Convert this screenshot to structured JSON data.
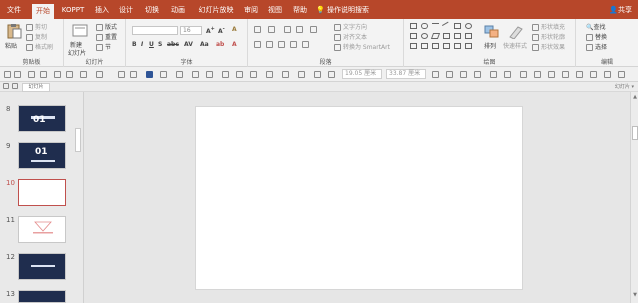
{
  "menu": {
    "tabs": [
      "文件",
      "开始",
      "KOPPT",
      "插入",
      "设计",
      "切换",
      "动画",
      "幻灯片放映",
      "审阅",
      "视图",
      "帮助"
    ],
    "active_tab": "开始",
    "tell_me": "操作说明搜索",
    "share": "共享"
  },
  "ribbon": {
    "clipboard": {
      "paste": "粘贴",
      "cut": "剪切",
      "copy": "复制",
      "format_painter": "格式刷",
      "label": "剪贴板"
    },
    "slides": {
      "new_slide_1": "新建",
      "new_slide_2": "幻灯片",
      "layout": "版式",
      "reset": "重置",
      "section": "节",
      "label": "幻灯片"
    },
    "font": {
      "font_size": "16",
      "label": "字体"
    },
    "paragraph": {
      "text_direction": "文字方向",
      "align_text": "对齐文本",
      "smartart": "转换为 SmartArt",
      "label": "段落"
    },
    "drawing": {
      "arrange": "排列",
      "quick_styles": "快速样式",
      "shape_fill": "形状填充",
      "shape_outline": "形状轮廓",
      "shape_effects": "形状效果",
      "label": "绘图"
    },
    "editing": {
      "find": "查找",
      "replace": "替换",
      "select": "选择",
      "label": "编辑"
    }
  },
  "toolbar2": {
    "width_field": "19.05 厘米",
    "height_field": "33.87 厘米"
  },
  "strip": {
    "doc_tab": "幻灯片",
    "right_text": "幻灯片 ▾"
  },
  "thumbnails": [
    {
      "number": "8",
      "style": "dark",
      "big": "01",
      "sub": ""
    },
    {
      "number": "9",
      "style": "dark",
      "big": "01",
      "sub": ""
    },
    {
      "number": "10",
      "style": "active",
      "big": "",
      "sub": ""
    },
    {
      "number": "11",
      "style": "light",
      "big": "",
      "sub": ""
    },
    {
      "number": "12",
      "style": "dark",
      "big": "",
      "sub": ""
    },
    {
      "number": "13",
      "style": "dark",
      "big": "",
      "sub": ""
    }
  ]
}
